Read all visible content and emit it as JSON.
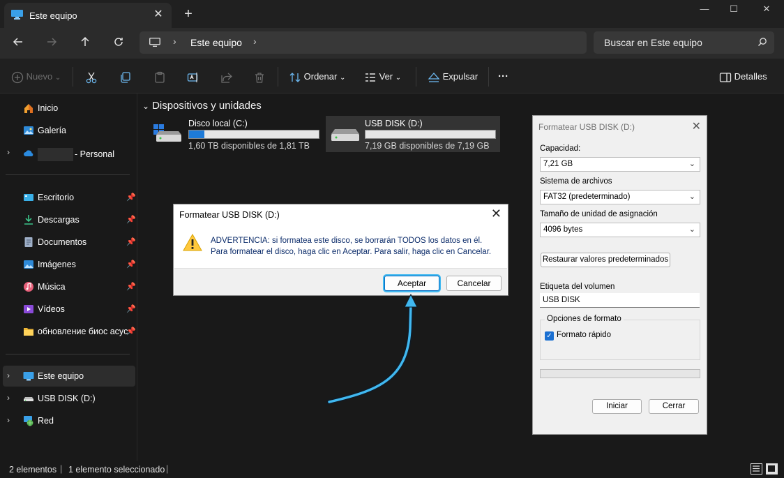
{
  "window": {
    "tab_title": "Este equipo",
    "tab_close": "✕",
    "new_tab": "+",
    "minimize": "—",
    "maximize": "☐",
    "close": "✕"
  },
  "address": {
    "sep": "›",
    "crumb": "Este equipo",
    "search_placeholder": "Buscar en Este equipo"
  },
  "toolbar": {
    "new_label": "Nuevo",
    "sort_label": "Ordenar",
    "view_label": "Ver",
    "eject_label": "Expulsar",
    "more": "···",
    "details_label": "Detalles"
  },
  "sidebar": {
    "home": "Inicio",
    "gallery": "Galería",
    "onedrive": "- Personal",
    "desktop": "Escritorio",
    "downloads": "Descargas",
    "documents": "Documentos",
    "images": "Imágenes",
    "music": "Música",
    "videos": "Vídeos",
    "folder": "обновление биос acyc",
    "this_pc": "Este equipo",
    "usb": "USB DISK (D:)",
    "network": "Red",
    "pin": "📌",
    "chevron": "›"
  },
  "main": {
    "group_title": "Dispositivos y unidades",
    "drives": [
      {
        "name": "Disco local (C:)",
        "free": "1,60 TB disponibles de 1,81 TB",
        "used_fraction": 0.116
      },
      {
        "name": "USB DISK (D:)",
        "free": "7,19 GB disponibles de 7,19 GB",
        "used_fraction": 0.0
      }
    ]
  },
  "status": {
    "items": "2 elementos",
    "selected": "1 elemento seleccionado",
    "sep": "|"
  },
  "format_dialog": {
    "title": "Formatear USB DISK (D:)",
    "close": "✕",
    "capacity_label": "Capacidad:",
    "capacity_value": "7,21 GB",
    "fs_label": "Sistema de archivos",
    "fs_value": "FAT32 (predeterminado)",
    "alloc_label": "Tamaño de unidad de asignación",
    "alloc_value": "4096 bytes",
    "restore_label": "Restaurar valores predeterminados",
    "volume_label": "Etiqueta del volumen",
    "volume_value": "USB DISK",
    "options_label": "Opciones de formato",
    "quick_label": "Formato rápido",
    "quick_checked": true,
    "progress": 0,
    "start_label": "Iniciar",
    "close_label": "Cerrar",
    "dropdown": "⌄"
  },
  "warning_dialog": {
    "title": "Formatear USB DISK (D:)",
    "close": "✕",
    "line1": "ADVERTENCIA: si formatea este disco, se borrarán TODOS los datos en él.",
    "line2": "Para formatear el disco, haga clic en Aceptar. Para salir, haga clic en Cancelar.",
    "ok_label": "Aceptar",
    "cancel_label": "Cancelar"
  },
  "colors": {
    "accent": "#40b8f0",
    "drive_fill": "#1e7bd8",
    "warning_yellow": "#ffc83d"
  }
}
